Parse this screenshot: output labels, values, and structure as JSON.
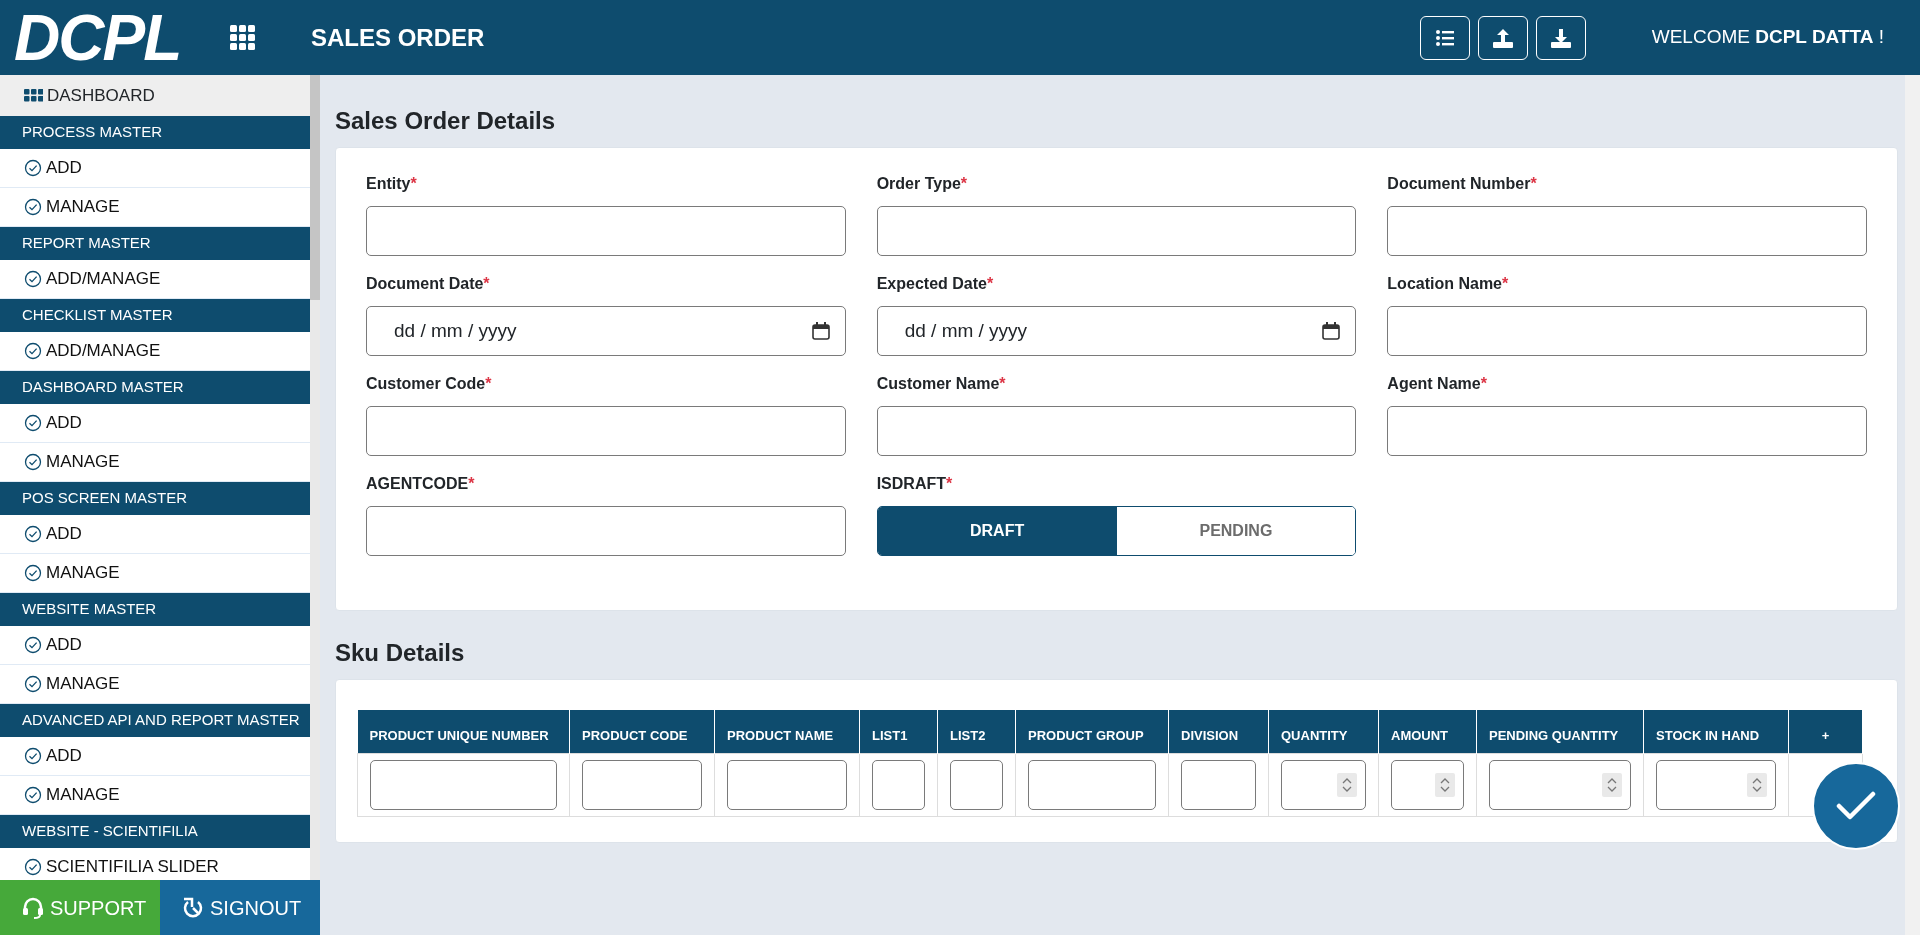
{
  "header": {
    "logo": "DCPL",
    "page_title": "SALES ORDER",
    "welcome": "WELCOME **DCPL DATTA** !"
  },
  "sidebar": {
    "dashboard": "DASHBOARD",
    "sections": [
      {
        "title": "PROCESS MASTER",
        "items": [
          "ADD",
          "MANAGE"
        ]
      },
      {
        "title": "REPORT MASTER",
        "items": [
          "ADD/MANAGE"
        ]
      },
      {
        "title": "CHECKLIST MASTER",
        "items": [
          "ADD/MANAGE"
        ]
      },
      {
        "title": "DASHBOARD MASTER",
        "items": [
          "ADD",
          "MANAGE"
        ]
      },
      {
        "title": "POS SCREEN MASTER",
        "items": [
          "ADD",
          "MANAGE"
        ]
      },
      {
        "title": "WEBSITE MASTER",
        "items": [
          "ADD",
          "MANAGE"
        ]
      },
      {
        "title": "ADVANCED API AND REPORT MASTER",
        "items": [
          "ADD",
          "MANAGE"
        ]
      },
      {
        "title": "WEBSITE - SCIENTIFILIA",
        "items": [
          "SCIENTIFILIA SLIDER"
        ]
      }
    ],
    "footer": [
      {
        "kind": "support",
        "label": "SUPPORT"
      },
      {
        "kind": "signout",
        "label": "SIGNOUT"
      }
    ]
  },
  "order_details": {
    "title": "Sales Order Details",
    "fields": [
      {
        "label": "Entity",
        "mark": "*",
        "kind": "text"
      },
      {
        "label": "Order Type",
        "mark": "*",
        "kind": "text"
      },
      {
        "label": "Document Number",
        "mark": "*",
        "kind": "text"
      },
      {
        "label": "Document Date",
        "mark": "*",
        "kind": "date",
        "placeholder": "dd / mm / yyyy"
      },
      {
        "label": "Expected Date",
        "mark": "*",
        "kind": "date",
        "placeholder": "dd / mm / yyyy"
      },
      {
        "label": "Location Name",
        "mark": "*",
        "kind": "text"
      },
      {
        "label": "Customer Code",
        "mark": "*",
        "kind": "text"
      },
      {
        "label": "Customer Name",
        "mark": "*",
        "kind": "text"
      },
      {
        "label": "Agent Name",
        "mark": "*",
        "kind": "text"
      },
      {
        "label": "AGENTCODE",
        "mark": "*",
        "kind": "text"
      },
      {
        "label": "ISDRAFT",
        "mark": "*",
        "kind": "toggle",
        "options": [
          {
            "label": "DRAFT",
            "selected": true
          },
          {
            "label": "PENDING",
            "selected": false
          }
        ]
      }
    ]
  },
  "sku_details": {
    "title": "Sku Details",
    "add_label": "+",
    "columns": [
      {
        "label": "PRODUCT UNIQUE NUMBER",
        "kind": "text"
      },
      {
        "label": "PRODUCT CODE",
        "kind": "text"
      },
      {
        "label": "PRODUCT NAME",
        "kind": "text"
      },
      {
        "label": "LIST1",
        "kind": "text"
      },
      {
        "label": "LIST2",
        "kind": "text"
      },
      {
        "label": "PRODUCT GROUP",
        "kind": "text"
      },
      {
        "label": "DIVISION",
        "kind": "text"
      },
      {
        "label": "QUANTITY",
        "kind": "number"
      },
      {
        "label": "AMOUNT",
        "kind": "number"
      },
      {
        "label": "PENDING QUANTITY",
        "kind": "number"
      },
      {
        "label": "STOCK IN HAND",
        "kind": "number"
      }
    ]
  }
}
